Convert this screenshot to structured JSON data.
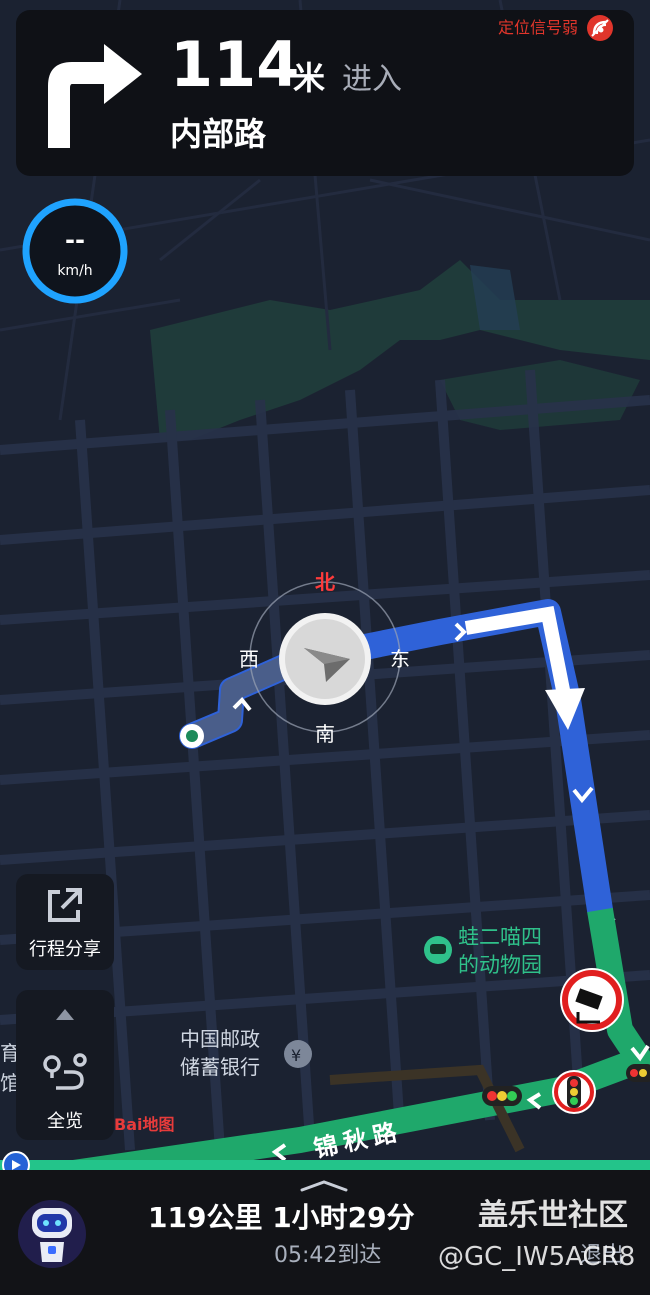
{
  "maneuver": {
    "distance": "114",
    "unit": "米",
    "action": "进入",
    "road": "内部路",
    "icon": "turn-right-icon"
  },
  "gps": {
    "status": "定位信号弱",
    "icon": "weak-signal-icon",
    "color": "#e0352b"
  },
  "speed": {
    "value": "--",
    "unit": "km/h"
  },
  "compass": {
    "north": "北",
    "south": "南",
    "east": "东",
    "west": "西"
  },
  "map": {
    "poi_zoo": "蛙二喵四",
    "poi_zoo_line2": "的动物园",
    "poi_bank": "中国邮政",
    "poi_bank_line2": "储蓄银行",
    "road_label": "锦秋路",
    "partial_left_1": "育",
    "partial_left_2": "馆",
    "brand": "Bai地图"
  },
  "side_buttons": {
    "share_label": "行程分享",
    "overview_label": "全览"
  },
  "trip": {
    "summary": "119公里 1小时29分",
    "eta": "05:42到达",
    "exit_label": "退出"
  },
  "watermark": {
    "line1": "盖乐世社区",
    "line2": "@GC_IW5ACR8"
  },
  "colors": {
    "route_blue": "#2f62d8",
    "route_green": "#1fa86b",
    "accent": "#1fa3ff",
    "background": "#1b2231"
  }
}
